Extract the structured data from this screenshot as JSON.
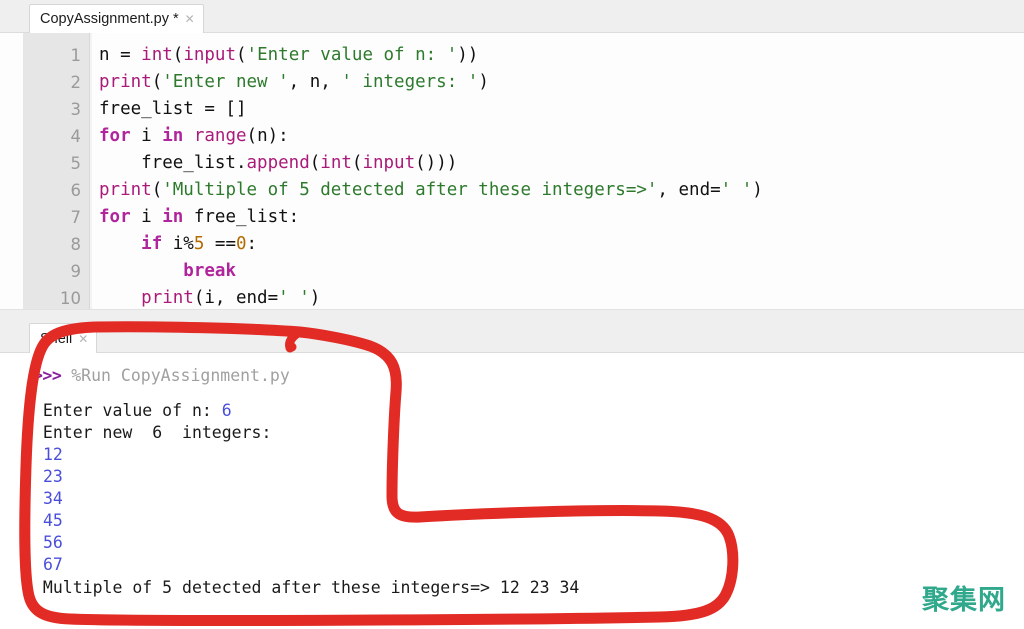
{
  "editor": {
    "tab": {
      "label": "CopyAssignment.py *",
      "close_icon": "close-icon"
    },
    "lines": [
      {
        "no": "1",
        "segments": [
          {
            "t": "n = ",
            "c": "pl"
          },
          {
            "t": "int",
            "c": "fn"
          },
          {
            "t": "(",
            "c": "pl"
          },
          {
            "t": "input",
            "c": "fn"
          },
          {
            "t": "(",
            "c": "pl"
          },
          {
            "t": "'Enter value of n: '",
            "c": "str"
          },
          {
            "t": "))",
            "c": "pl"
          }
        ]
      },
      {
        "no": "2",
        "segments": [
          {
            "t": "print",
            "c": "fn"
          },
          {
            "t": "(",
            "c": "pl"
          },
          {
            "t": "'Enter new '",
            "c": "str"
          },
          {
            "t": ", n, ",
            "c": "pl"
          },
          {
            "t": "' integers: '",
            "c": "str"
          },
          {
            "t": ")",
            "c": "pl"
          }
        ]
      },
      {
        "no": "3",
        "segments": [
          {
            "t": "free_list = []",
            "c": "pl"
          }
        ]
      },
      {
        "no": "4",
        "segments": [
          {
            "t": "for",
            "c": "kw"
          },
          {
            "t": " i ",
            "c": "pl"
          },
          {
            "t": "in",
            "c": "kw"
          },
          {
            "t": " ",
            "c": "pl"
          },
          {
            "t": "range",
            "c": "fn"
          },
          {
            "t": "(n):",
            "c": "pl"
          }
        ]
      },
      {
        "no": "5",
        "segments": [
          {
            "t": "    free_list.",
            "c": "pl"
          },
          {
            "t": "append",
            "c": "fn"
          },
          {
            "t": "(",
            "c": "pl"
          },
          {
            "t": "int",
            "c": "fn"
          },
          {
            "t": "(",
            "c": "pl"
          },
          {
            "t": "input",
            "c": "fn"
          },
          {
            "t": "()))",
            "c": "pl"
          }
        ]
      },
      {
        "no": "6",
        "segments": [
          {
            "t": "print",
            "c": "fn"
          },
          {
            "t": "(",
            "c": "pl"
          },
          {
            "t": "'Multiple of 5 detected after these integers=>'",
            "c": "str"
          },
          {
            "t": ", end=",
            "c": "pl"
          },
          {
            "t": "' '",
            "c": "str"
          },
          {
            "t": ")",
            "c": "pl"
          }
        ]
      },
      {
        "no": "7",
        "segments": [
          {
            "t": "for",
            "c": "kw"
          },
          {
            "t": " i ",
            "c": "pl"
          },
          {
            "t": "in",
            "c": "kw"
          },
          {
            "t": " free_list:",
            "c": "pl"
          }
        ]
      },
      {
        "no": "8",
        "segments": [
          {
            "t": "    ",
            "c": "pl"
          },
          {
            "t": "if",
            "c": "kw"
          },
          {
            "t": " i%",
            "c": "pl"
          },
          {
            "t": "5",
            "c": "num"
          },
          {
            "t": " ==",
            "c": "pl"
          },
          {
            "t": "0",
            "c": "num"
          },
          {
            "t": ":",
            "c": "pl"
          }
        ]
      },
      {
        "no": "9",
        "segments": [
          {
            "t": "        ",
            "c": "pl"
          },
          {
            "t": "break",
            "c": "kw"
          }
        ]
      },
      {
        "no": "10",
        "segments": [
          {
            "t": "    ",
            "c": "pl"
          },
          {
            "t": "print",
            "c": "fn"
          },
          {
            "t": "(i, end=",
            "c": "pl"
          },
          {
            "t": "' '",
            "c": "str"
          },
          {
            "t": ")",
            "c": "pl"
          }
        ]
      }
    ]
  },
  "shell": {
    "tab": {
      "label": "Shell",
      "close_icon": "close-icon"
    },
    "lines": [
      {
        "segments": [
          {
            "t": ">>>",
            "c": "prompt"
          },
          {
            "t": " %Run CopyAssignment.py",
            "c": "cmd"
          }
        ]
      },
      {
        "segments": [
          {
            "t": " Enter value of n: ",
            "c": "out"
          },
          {
            "t": "6",
            "c": "in"
          }
        ]
      },
      {
        "segments": [
          {
            "t": " Enter new  6  integers:",
            "c": "out"
          }
        ]
      },
      {
        "segments": [
          {
            "t": " ",
            "c": "out"
          },
          {
            "t": "12",
            "c": "in"
          }
        ]
      },
      {
        "segments": [
          {
            "t": " ",
            "c": "out"
          },
          {
            "t": "23",
            "c": "in"
          }
        ]
      },
      {
        "segments": [
          {
            "t": " ",
            "c": "out"
          },
          {
            "t": "34",
            "c": "in"
          }
        ]
      },
      {
        "segments": [
          {
            "t": " ",
            "c": "out"
          },
          {
            "t": "45",
            "c": "in"
          }
        ]
      },
      {
        "segments": [
          {
            "t": " ",
            "c": "out"
          },
          {
            "t": "56",
            "c": "in"
          }
        ]
      },
      {
        "segments": [
          {
            "t": " ",
            "c": "out"
          },
          {
            "t": "67",
            "c": "in"
          }
        ]
      },
      {
        "segments": [
          {
            "t": " Multiple of 5 detected after these integers=> 12 23 34",
            "c": "out"
          }
        ]
      }
    ]
  },
  "annotation": {
    "name": "red-highlight-outline",
    "color": "#E22B25",
    "stroke_width": 11
  },
  "watermark": {
    "text": "聚集网",
    "color": "#2fa88c"
  }
}
